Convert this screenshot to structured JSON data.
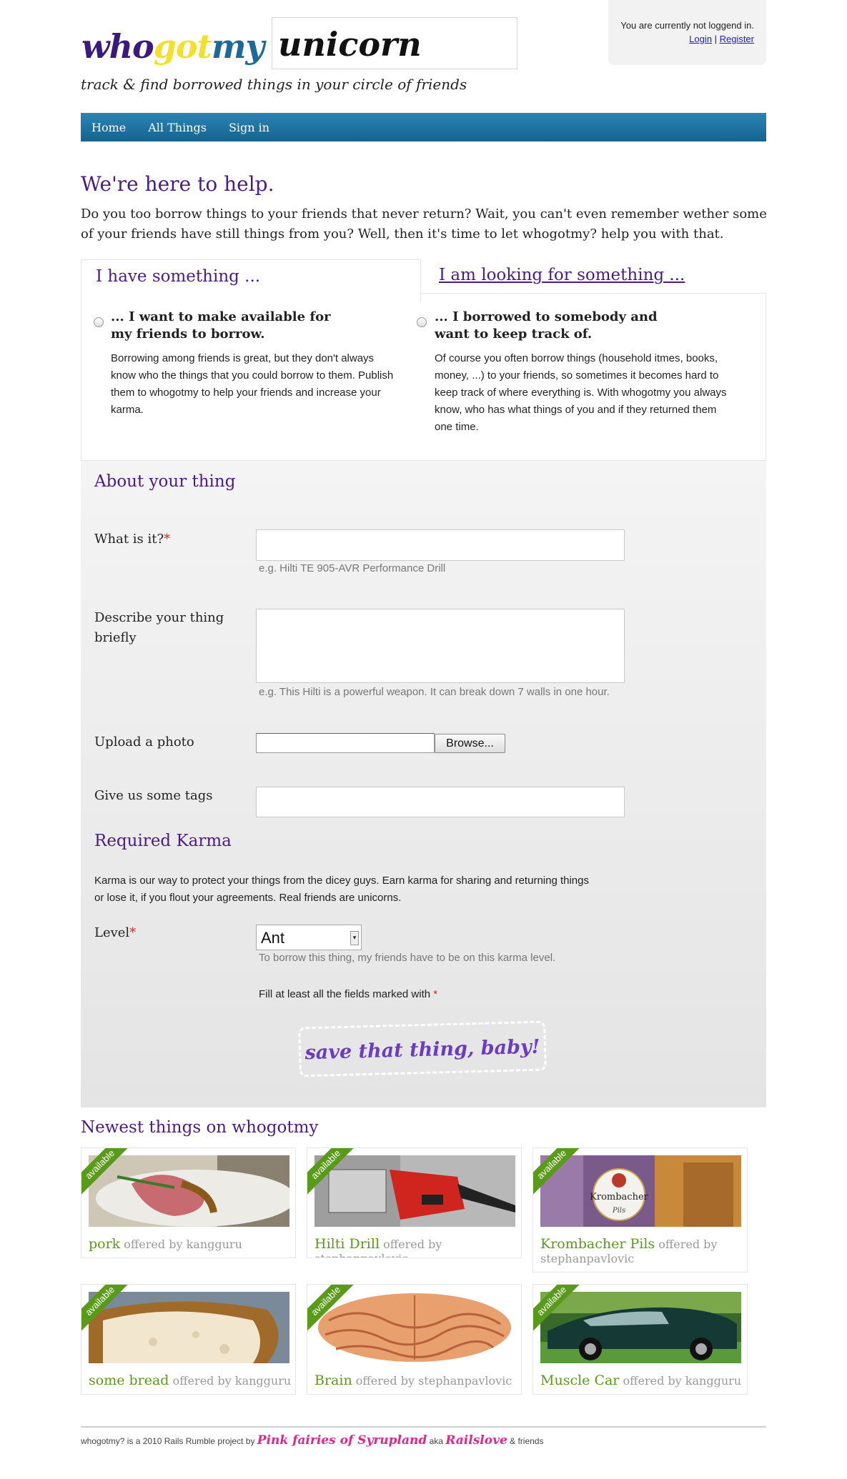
{
  "header": {
    "logo_part1": "who",
    "logo_part2": "got",
    "logo_part3": "my",
    "logo_box_word": "unicorn",
    "tagline": "track & find borrowed things in your circle of friends",
    "login_status": "You are currently not loggend in.",
    "login_link": "Login",
    "separator": " | ",
    "register_link": "Register"
  },
  "nav": {
    "items": [
      "Home",
      "All Things",
      "Sign in"
    ]
  },
  "intro": {
    "title": "We're here to help.",
    "text": "Do you too borrow things to your friends that never return? Wait, you can't even remember wether some of your friends have still things from you? Well, then it's time to let whogotmy? help you with that."
  },
  "tabs": {
    "tab1": "I have something ...",
    "tab2": "I am looking for something ...",
    "option1_title_line1": "... I want to make available for",
    "option1_title_line2": "my friends to borrow.",
    "option1_text": "Borrowing among friends is great, but they don't always know who the things that you could borrow to them. Publish them to whogotmy to help your friends and increase your karma.",
    "option2_title_line1": "... I borrowed to somebody and",
    "option2_title_line2": "want to keep track of.",
    "option2_text": "Of course you often borrow things (household itmes, books, money, ...) to your friends, so sometimes it becomes hard to keep track of where everything is. With whogotmy you always know, who has what things of you and if they returned them one time."
  },
  "form": {
    "section_title": "About your thing",
    "what_label": "What is it?",
    "required_mark": "*",
    "what_value": "",
    "what_hint": "e.g. Hilti TE 905-AVR Performance Drill",
    "describe_label_line1": "Describe your thing",
    "describe_label_line2": "briefly",
    "describe_value": "",
    "describe_hint": "e.g. This Hilti is a powerful weapon. It can break down 7 walls in one hour.",
    "upload_label": "Upload a photo",
    "browse_button": "Browse...",
    "tags_label": "Give us some tags",
    "tags_value": "",
    "karma_title": "Required Karma",
    "karma_text_line1": "Karma is our way to protect your things from the dicey guys. Earn karma for sharing and returning things",
    "karma_text_line2": "or lose it, if you flout your agreements. Real friends are unicorns.",
    "level_label": "Level",
    "level_value": "Ant",
    "level_hint": "To borrow this thing, my friends have to be on this karma level.",
    "fill_note": "Fill at least all the fields marked with ",
    "submit_button": "save that thing, baby!"
  },
  "newest": {
    "title": "Newest things on whogotmy",
    "badge": "available",
    "offered_by": "offered by",
    "items": [
      {
        "name": "pork",
        "owner": "kangguru"
      },
      {
        "name": "Hilti Drill",
        "owner": "stephanpavlovic"
      },
      {
        "name": "Krombacher Pils",
        "owner": "stephanpavlovic"
      },
      {
        "name": "some bread",
        "owner": "kangguru"
      },
      {
        "name": "Brain",
        "owner": "stephanpavlovic"
      },
      {
        "name": "Muscle Car",
        "owner": "kangguru"
      }
    ],
    "image_labels": [
      "Krombacher",
      "Pils"
    ]
  },
  "footer": {
    "prefix": "whogotmy? is a 2010 Rails Rumble project by ",
    "team": "Pink fairies of Syrupland",
    "aka": " aka ",
    "alias": "Railslove",
    "suffix": " & friends"
  },
  "colors": {
    "brand_purple": "#4b1b86",
    "nav_blue": "#1e74a3",
    "available_green": "#5a9a1a",
    "footer_pink": "#e6238a"
  }
}
